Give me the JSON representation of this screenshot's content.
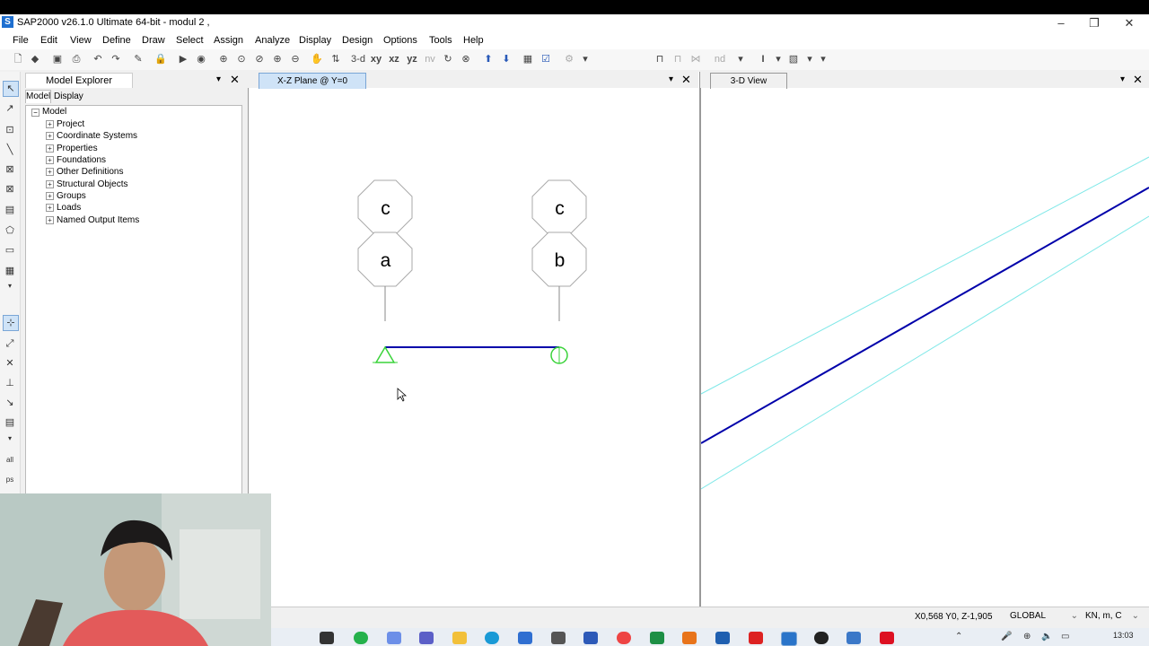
{
  "window": {
    "title": "SAP2000 v26.1.0 Ultimate 64-bit - modul 2 ,",
    "app_icon": "S"
  },
  "menu": [
    "File",
    "Edit",
    "View",
    "Define",
    "Draw",
    "Select",
    "Assign",
    "Analyze",
    "Display",
    "Design",
    "Options",
    "Tools",
    "Help"
  ],
  "toolbar": {
    "view_3d": "3-d",
    "view_xy": "xy",
    "view_xz": "xz",
    "view_yz": "yz",
    "view_nv": "nv",
    "nd_label": "nd"
  },
  "explorer": {
    "title": "Model Explorer",
    "tabs": [
      "Model",
      "Display"
    ],
    "root": "Model",
    "items": [
      "Project",
      "Coordinate Systems",
      "Properties",
      "Foundations",
      "Other Definitions",
      "Structural Objects",
      "Groups",
      "Loads",
      "Named Output Items"
    ]
  },
  "views": {
    "left_title": "X-Z Plane @ Y=0",
    "right_title": "3-D View"
  },
  "drawing": {
    "load_labels": [
      "c",
      "a",
      "c",
      "b"
    ]
  },
  "statusbar": {
    "coords": "X0,568  Y0,  Z-1,905",
    "coord_system": "GLOBAL",
    "units": "KN, m, C"
  },
  "taskbar": {
    "time": "13:03"
  },
  "colors": {
    "beam": "#0000aa",
    "support": "#3ad33a",
    "guide_lines": "#7fe8e8",
    "app_icon": "#1e6fd0"
  },
  "icons": {
    "minimize": "minimize-icon",
    "maximize": "restore-icon",
    "close": "close-icon",
    "pin": "pin-dropdown-icon"
  }
}
